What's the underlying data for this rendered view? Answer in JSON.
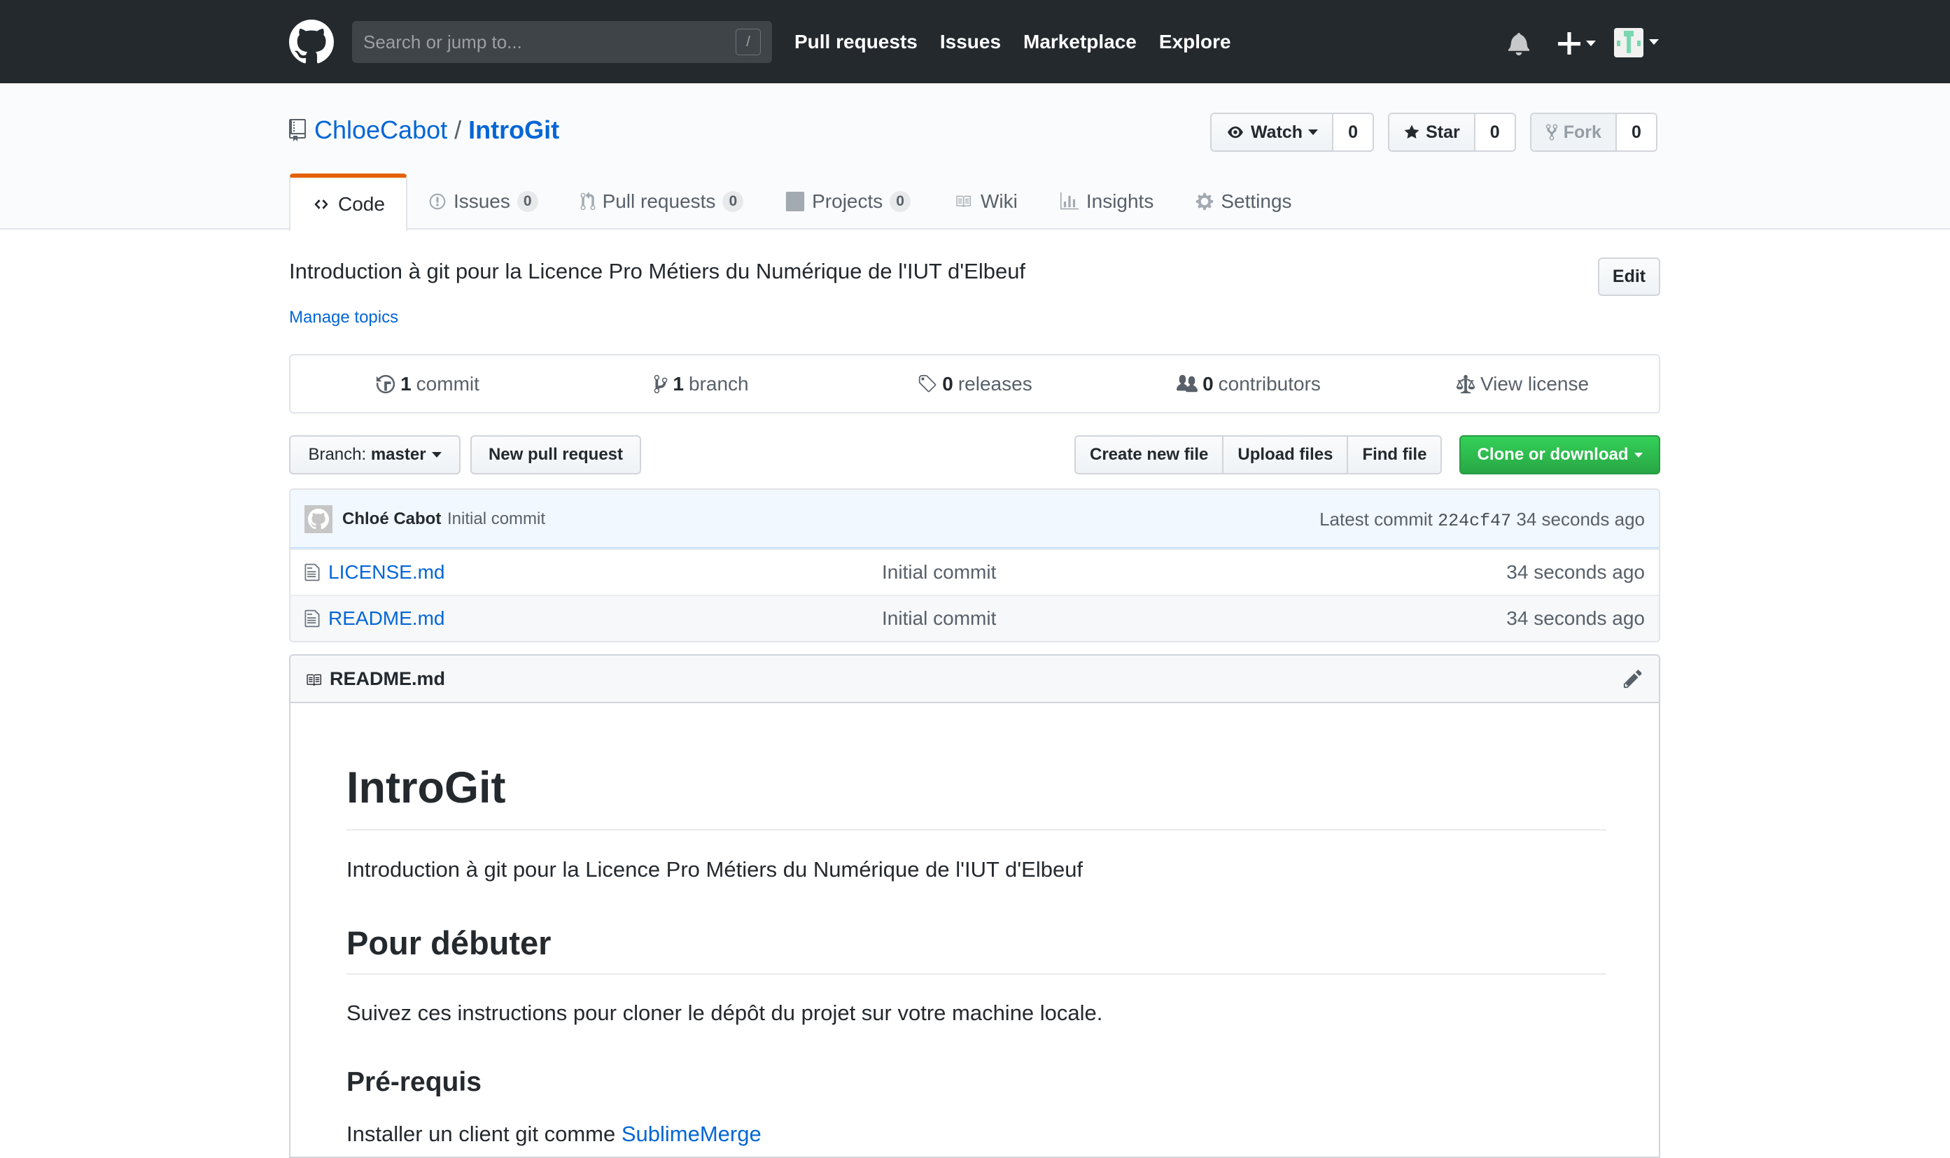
{
  "header": {
    "search_placeholder": "Search or jump to...",
    "search_shortcut": "/",
    "nav": [
      "Pull requests",
      "Issues",
      "Marketplace",
      "Explore"
    ],
    "colors": {
      "background": "#24292e",
      "avatar_accent": "#79d7b0"
    }
  },
  "repo": {
    "owner": "ChloeCabot",
    "separator": "/",
    "name": "IntroGit",
    "actions": {
      "watch": {
        "label": "Watch",
        "count": "0"
      },
      "star": {
        "label": "Star",
        "count": "0"
      },
      "fork": {
        "label": "Fork",
        "count": "0"
      }
    },
    "tabs": [
      {
        "label": "Code",
        "counter": null,
        "selected": true
      },
      {
        "label": "Issues",
        "counter": "0"
      },
      {
        "label": "Pull requests",
        "counter": "0"
      },
      {
        "label": "Projects",
        "counter": "0"
      },
      {
        "label": "Wiki",
        "counter": null
      },
      {
        "label": "Insights",
        "counter": null
      },
      {
        "label": "Settings",
        "counter": null
      }
    ],
    "selected_tab_accent": "#e36209"
  },
  "description": {
    "text": "Introduction à git pour la Licence Pro Métiers du Numérique de l'IUT d'Elbeuf",
    "edit_label": "Edit",
    "manage_topics": "Manage topics"
  },
  "summary": {
    "commits": {
      "count": "1",
      "label": "commit"
    },
    "branches": {
      "count": "1",
      "label": "branch"
    },
    "releases": {
      "count": "0",
      "label": "releases"
    },
    "contributors": {
      "count": "0",
      "label": "contributors"
    },
    "license": {
      "label": "View license"
    }
  },
  "file_nav": {
    "branch_prefix": "Branch:",
    "branch_name": "master",
    "new_pull_request": "New pull request",
    "create_new_file": "Create new file",
    "upload_files": "Upload files",
    "find_file": "Find file",
    "clone_or_download": "Clone or download",
    "clone_color": "#28a745"
  },
  "commit_tease": {
    "author": "Chloé Cabot",
    "message": "Initial commit",
    "latest_prefix": "Latest commit",
    "sha": "224cf47",
    "age": "34 seconds ago"
  },
  "files": [
    {
      "name": "LICENSE.md",
      "message": "Initial commit",
      "age": "34 seconds ago"
    },
    {
      "name": "README.md",
      "message": "Initial commit",
      "age": "34 seconds ago"
    }
  ],
  "readme": {
    "filename": "README.md",
    "h1": "IntroGit",
    "p1": "Introduction à git pour la Licence Pro Métiers du Numérique de l'IUT d'Elbeuf",
    "h2": "Pour débuter",
    "p2": "Suivez ces instructions pour cloner le dépôt du projet sur votre machine locale.",
    "h3": "Pré-requis",
    "p3_text": "Installer un client git comme ",
    "p3_link": "SublimeMerge"
  }
}
